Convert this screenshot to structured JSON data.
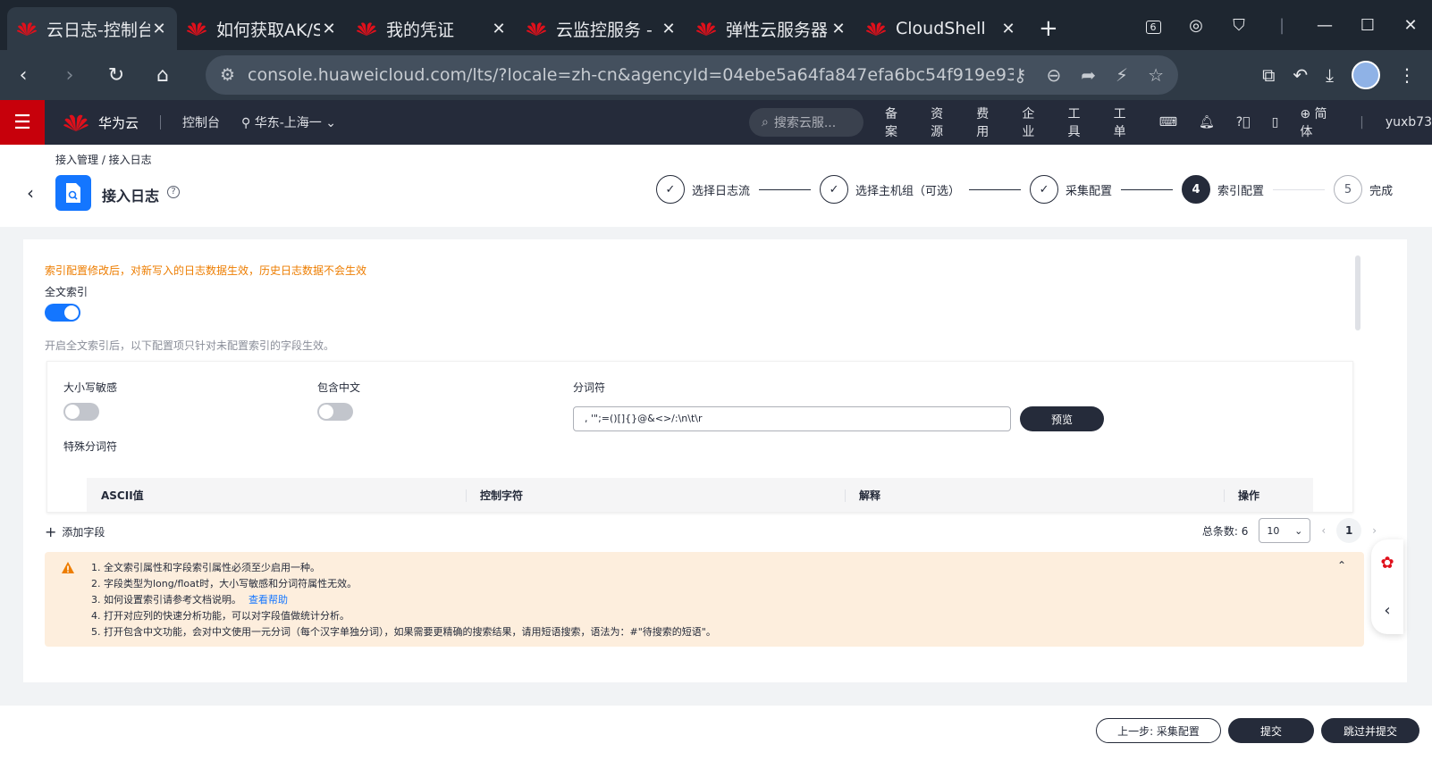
{
  "browser": {
    "tabs": [
      {
        "title": "云日志-控制台",
        "active": true
      },
      {
        "title": "如何获取AK/SK",
        "active": false
      },
      {
        "title": "我的凭证",
        "active": false
      },
      {
        "title": "云监控服务 -",
        "active": false
      },
      {
        "title": "弹性云服务器",
        "active": false
      },
      {
        "title": "CloudShell",
        "active": false
      }
    ],
    "url": "console.huaweicloud.com/lts/?locale=zh-cn&agencyId=04ebe5a64fa847efa6bc54f919e93...",
    "tab_count_badge": "6",
    "accent": "#c7000b"
  },
  "header": {
    "brand": "华为云",
    "console": "控制台",
    "region": "华东-上海一",
    "search_placeholder": "搜索云服...",
    "links": [
      "备案",
      "资源",
      "费用",
      "企业",
      "工具",
      "工单"
    ],
    "lang": "简体",
    "user": "yuxb73"
  },
  "page": {
    "breadcrumb": "接入管理 / 接入日志",
    "title": "接入日志",
    "steps": [
      {
        "label": "选择日志流",
        "state": "done"
      },
      {
        "label": "选择主机组（可选）",
        "state": "done"
      },
      {
        "label": "采集配置",
        "state": "done"
      },
      {
        "num": "4",
        "label": "索引配置",
        "state": "current"
      },
      {
        "num": "5",
        "label": "完成",
        "state": "todo"
      }
    ]
  },
  "index_config": {
    "warning": "索引配置修改后，对新写入的日志数据生效，历史日志数据不会生效",
    "fulltext_label": "全文索引",
    "fulltext_enabled": true,
    "fulltext_hint": "开启全文索引后，以下配置项只针对未配置索引的字段生效。",
    "case_sensitive_label": "大小写敏感",
    "case_sensitive": false,
    "chinese_label": "包含中文",
    "chinese": false,
    "delimiter_label": "分词符",
    "delimiter_value": ", '\";=()[]{}@&<>/:\\n\\t\\r",
    "preview_btn": "预览",
    "special_label": "特殊分词符",
    "table_headers": [
      "ASCII值",
      "控制字符",
      "解释",
      "操作"
    ],
    "add_field": "添加字段",
    "total_label": "总条数:",
    "total": "6",
    "page_size": "10",
    "current_page": "1",
    "notes": [
      "1. 全文索引属性和字段索引属性必须至少启用一种。",
      "2. 字段类型为long/float时，大小写敏感和分词符属性无效。",
      "3. 如何设置索引请参考文档说明。",
      "4. 打开对应列的快速分析功能，可以对字段值做统计分析。",
      "5. 打开包含中文功能，会对中文使用一元分词（每个汉字单独分词），如果需要更精确的搜索结果，请用短语搜索，语法为：#\"待搜索的短语\"。"
    ],
    "help_link": "查看帮助"
  },
  "footer": {
    "prev": "上一步: 采集配置",
    "submit": "提交",
    "skip_submit": "跳过并提交"
  }
}
